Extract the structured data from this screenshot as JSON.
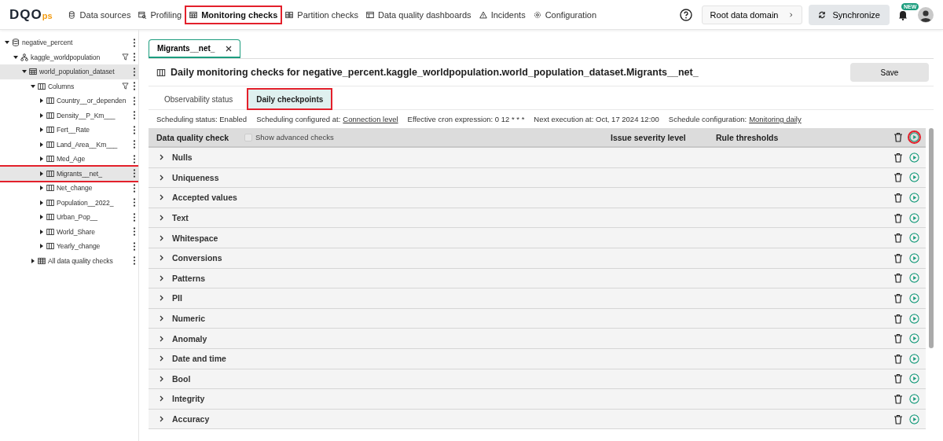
{
  "header": {
    "logo": {
      "main": "DQO",
      "suffix": "ps"
    },
    "nav": [
      {
        "label": "Data sources",
        "kind": "sources",
        "selected": false,
        "highlighted": false
      },
      {
        "label": "Profiling",
        "kind": "profiling",
        "selected": false,
        "highlighted": false
      },
      {
        "label": "Monitoring checks",
        "kind": "table",
        "selected": true,
        "highlighted": true
      },
      {
        "label": "Partition checks",
        "kind": "partition",
        "selected": false,
        "highlighted": false
      },
      {
        "label": "Data quality dashboards",
        "kind": "dashboard",
        "selected": false,
        "highlighted": false
      },
      {
        "label": "Incidents",
        "kind": "warning",
        "selected": false,
        "highlighted": false
      },
      {
        "label": "Configuration",
        "kind": "gear",
        "selected": false,
        "highlighted": false
      }
    ],
    "domain_button": "Root data domain",
    "sync_button": "Synchronize",
    "notification_badge": "NEW"
  },
  "sidebar": {
    "tree": [
      {
        "label": "negative_percent",
        "kind": "database",
        "expanded": true,
        "selected": false,
        "highlighted": false,
        "filter": false,
        "children": [
          {
            "label": "kaggle_worldpopulation",
            "kind": "schema",
            "expanded": true,
            "selected": false,
            "highlighted": false,
            "filter": true,
            "children": [
              {
                "label": "world_population_dataset",
                "kind": "table",
                "expanded": true,
                "selected": true,
                "highlighted": false,
                "filter": false,
                "children": [
                  {
                    "label": "Columns",
                    "kind": "columns",
                    "expanded": true,
                    "selected": false,
                    "highlighted": false,
                    "filter": true,
                    "children": [
                      {
                        "label": "Country__or_dependen",
                        "kind": "columns",
                        "expanded": false,
                        "selected": false,
                        "highlighted": false,
                        "filter": false
                      },
                      {
                        "label": "Density__P_Km___",
                        "kind": "columns",
                        "expanded": false,
                        "selected": false,
                        "highlighted": false,
                        "filter": false
                      },
                      {
                        "label": "Fert__Rate",
                        "kind": "columns",
                        "expanded": false,
                        "selected": false,
                        "highlighted": false,
                        "filter": false
                      },
                      {
                        "label": "Land_Area__Km___",
                        "kind": "columns",
                        "expanded": false,
                        "selected": false,
                        "highlighted": false,
                        "filter": false
                      },
                      {
                        "label": "Med_Age",
                        "kind": "columns",
                        "expanded": false,
                        "selected": false,
                        "highlighted": false,
                        "filter": false
                      },
                      {
                        "label": "Migrants__net_",
                        "kind": "columns",
                        "expanded": false,
                        "selected": true,
                        "highlighted": true,
                        "filter": false
                      },
                      {
                        "label": "Net_change",
                        "kind": "columns",
                        "expanded": false,
                        "selected": false,
                        "highlighted": false,
                        "filter": false
                      },
                      {
                        "label": "Population__2022_",
                        "kind": "columns",
                        "expanded": false,
                        "selected": false,
                        "highlighted": false,
                        "filter": false
                      },
                      {
                        "label": "Urban_Pop__",
                        "kind": "columns",
                        "expanded": false,
                        "selected": false,
                        "highlighted": false,
                        "filter": false
                      },
                      {
                        "label": "World_Share",
                        "kind": "columns",
                        "expanded": false,
                        "selected": false,
                        "highlighted": false,
                        "filter": false
                      },
                      {
                        "label": "Yearly_change",
                        "kind": "columns",
                        "expanded": false,
                        "selected": false,
                        "highlighted": false,
                        "filter": false
                      }
                    ]
                  },
                  {
                    "label": "All data quality checks",
                    "kind": "grid",
                    "expanded": false,
                    "selected": false,
                    "highlighted": false,
                    "filter": false
                  }
                ]
              }
            ]
          }
        ]
      }
    ]
  },
  "main": {
    "tabs": [
      {
        "label": "Migrants__net_",
        "selected": true
      }
    ],
    "title": "Daily monitoring checks for negative_percent.kaggle_worldpopulation.world_population_dataset.Migrants__net_",
    "save_button": "Save",
    "subtabs": [
      {
        "label": "Observability status",
        "selected": false,
        "highlighted": false
      },
      {
        "label": "Daily checkpoints",
        "selected": true,
        "highlighted": true
      }
    ],
    "schedule": [
      {
        "label": "Scheduling status: Enabled"
      },
      {
        "label": "Scheduling configured at:",
        "link": "Connection level"
      },
      {
        "label": "Effective cron expression: 0 12 * * *"
      },
      {
        "label": "Next execution at: Oct, 17 2024 12:00"
      },
      {
        "label": "Schedule configuration:",
        "link": "Monitoring daily"
      }
    ],
    "table": {
      "columns": [
        "Data quality check",
        "Issue severity level",
        "Rule thresholds"
      ],
      "advanced_checkbox": {
        "label": "Show advanced checks",
        "checked": false
      },
      "run_all_highlighted": true,
      "rows": [
        {
          "name": "Nulls"
        },
        {
          "name": "Uniqueness"
        },
        {
          "name": "Accepted values"
        },
        {
          "name": "Text"
        },
        {
          "name": "Whitespace"
        },
        {
          "name": "Conversions"
        },
        {
          "name": "Patterns"
        },
        {
          "name": "PII"
        },
        {
          "name": "Numeric"
        },
        {
          "name": "Anomaly"
        },
        {
          "name": "Date and time"
        },
        {
          "name": "Bool"
        },
        {
          "name": "Integrity"
        },
        {
          "name": "Accuracy"
        }
      ]
    }
  }
}
